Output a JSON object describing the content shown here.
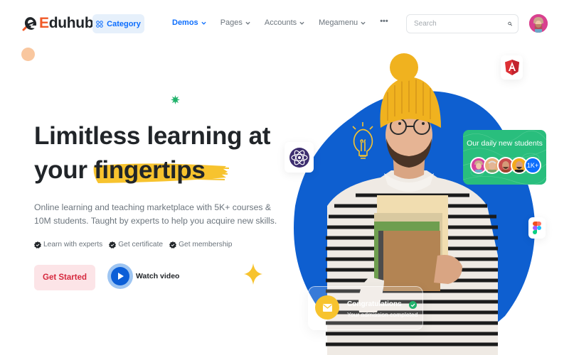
{
  "header": {
    "logo": {
      "first_letter": "E",
      "rest": "duhub"
    },
    "category_label": "Category",
    "nav": [
      {
        "label": "Demos",
        "active": true,
        "has_dropdown": true
      },
      {
        "label": "Pages",
        "active": false,
        "has_dropdown": true
      },
      {
        "label": "Accounts",
        "active": false,
        "has_dropdown": true
      },
      {
        "label": "Megamenu",
        "active": false,
        "has_dropdown": true
      }
    ],
    "more_label": "•••",
    "search": {
      "placeholder": "Search",
      "value": "",
      "icon": "search-icon"
    },
    "avatar_icon": "user-avatar"
  },
  "hero": {
    "title_line1": "Limitless learning at",
    "title_line2_prefix": "your ",
    "title_highlight": "fingertips",
    "description": "Online learning and teaching marketplace with 5K+ courses & 10M students. Taught by experts to help you acquire new skills.",
    "features": [
      {
        "label": "Learn with experts",
        "icon": "patch-check-icon"
      },
      {
        "label": "Get certificate",
        "icon": "patch-check-icon"
      },
      {
        "label": "Get membership",
        "icon": "patch-check-icon"
      }
    ],
    "cta_label": "Get Started",
    "watch_label": "Watch video"
  },
  "art": {
    "students_card": {
      "title": "Our daily new students",
      "more_count": "1K+"
    },
    "congrats_card": {
      "title": "Congratulations",
      "subtitle": "Your admission completed"
    },
    "icons": [
      "angular-icon",
      "atom-icon",
      "figma-icon",
      "lightbulb-icon"
    ]
  },
  "colors": {
    "primary": "#0d6efd",
    "brand_orange": "#f05a28",
    "cta_bg": "#fce4e7",
    "cta_text": "#d6293e",
    "highlight_yellow": "#f7c32e",
    "students_card_green": "#29be7d",
    "blob_blue": "#0e5fd0"
  }
}
